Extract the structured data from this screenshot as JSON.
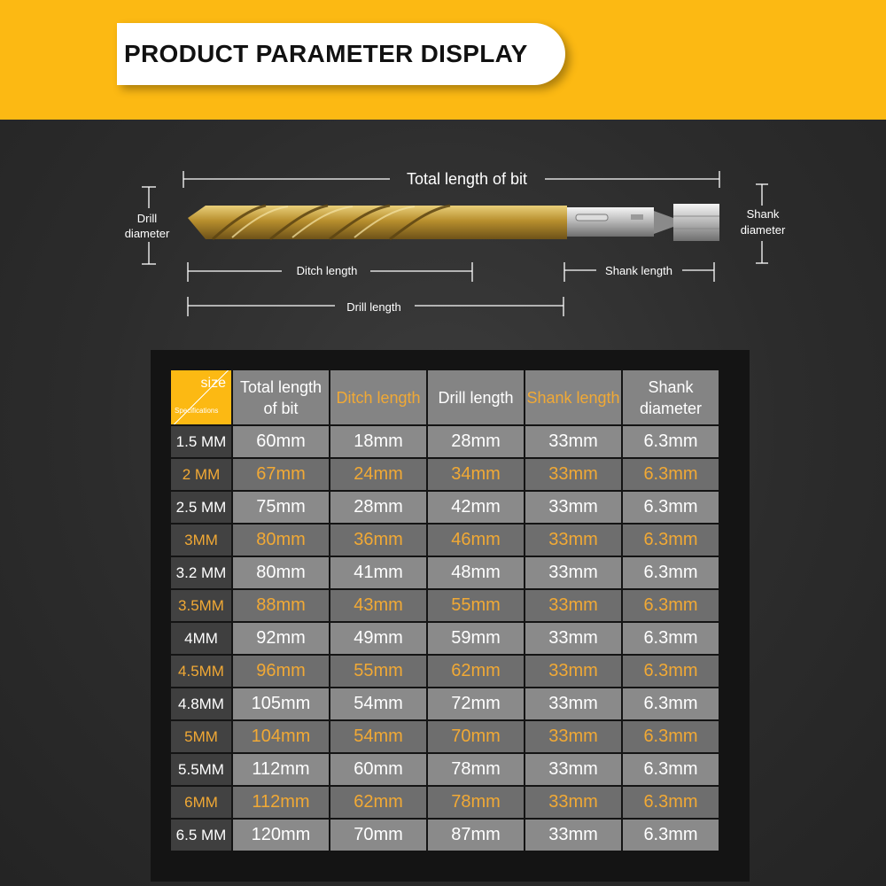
{
  "header": {
    "title": "PRODUCT PARAMETER DISPLAY"
  },
  "diagram": {
    "total_length": "Total length of bit",
    "drill_diameter_line1": "Drill",
    "drill_diameter_line2": "diameter",
    "shank_diameter_line1": "Shank",
    "shank_diameter_line2": "diameter",
    "ditch_length": "Ditch length",
    "shank_length": "Shank length",
    "drill_length": "Drill length"
  },
  "table": {
    "corner_size": "size",
    "corner_spec": "Specifications",
    "headers": [
      {
        "label": "Total length of bit",
        "color": "white"
      },
      {
        "label": "Ditch length",
        "color": "orange"
      },
      {
        "label": "Drill length",
        "color": "white"
      },
      {
        "label": "Shank length",
        "color": "orange"
      },
      {
        "label": "Shank diameter",
        "color": "white"
      }
    ],
    "rows": [
      {
        "size": "1.5 MM",
        "values": [
          "60mm",
          "18mm",
          "28mm",
          "33mm",
          "6.3mm"
        ]
      },
      {
        "size": "2 MM",
        "values": [
          "67mm",
          "24mm",
          "34mm",
          "33mm",
          "6.3mm"
        ]
      },
      {
        "size": "2.5 MM",
        "values": [
          "75mm",
          "28mm",
          "42mm",
          "33mm",
          "6.3mm"
        ]
      },
      {
        "size": "3MM",
        "values": [
          "80mm",
          "36mm",
          "46mm",
          "33mm",
          "6.3mm"
        ]
      },
      {
        "size": "3.2 MM",
        "values": [
          "80mm",
          "41mm",
          "48mm",
          "33mm",
          "6.3mm"
        ]
      },
      {
        "size": "3.5MM",
        "values": [
          "88mm",
          "43mm",
          "55mm",
          "33mm",
          "6.3mm"
        ]
      },
      {
        "size": "4MM",
        "values": [
          "92mm",
          "49mm",
          "59mm",
          "33mm",
          "6.3mm"
        ]
      },
      {
        "size": "4.5MM",
        "values": [
          "96mm",
          "55mm",
          "62mm",
          "33mm",
          "6.3mm"
        ]
      },
      {
        "size": "4.8MM",
        "values": [
          "105mm",
          "54mm",
          "72mm",
          "33mm",
          "6.3mm"
        ]
      },
      {
        "size": "5MM",
        "values": [
          "104mm",
          "54mm",
          "70mm",
          "33mm",
          "6.3mm"
        ]
      },
      {
        "size": "5.5MM",
        "values": [
          "112mm",
          "60mm",
          "78mm",
          "33mm",
          "6.3mm"
        ]
      },
      {
        "size": "6MM",
        "values": [
          "112mm",
          "62mm",
          "78mm",
          "33mm",
          "6.3mm"
        ]
      },
      {
        "size": "6.5 MM",
        "values": [
          "120mm",
          "70mm",
          "87mm",
          "33mm",
          "6.3mm"
        ]
      }
    ]
  },
  "colors": {
    "banner": "#fcb913",
    "accent_text": "#f1a935",
    "background": "#2b2b2b"
  }
}
